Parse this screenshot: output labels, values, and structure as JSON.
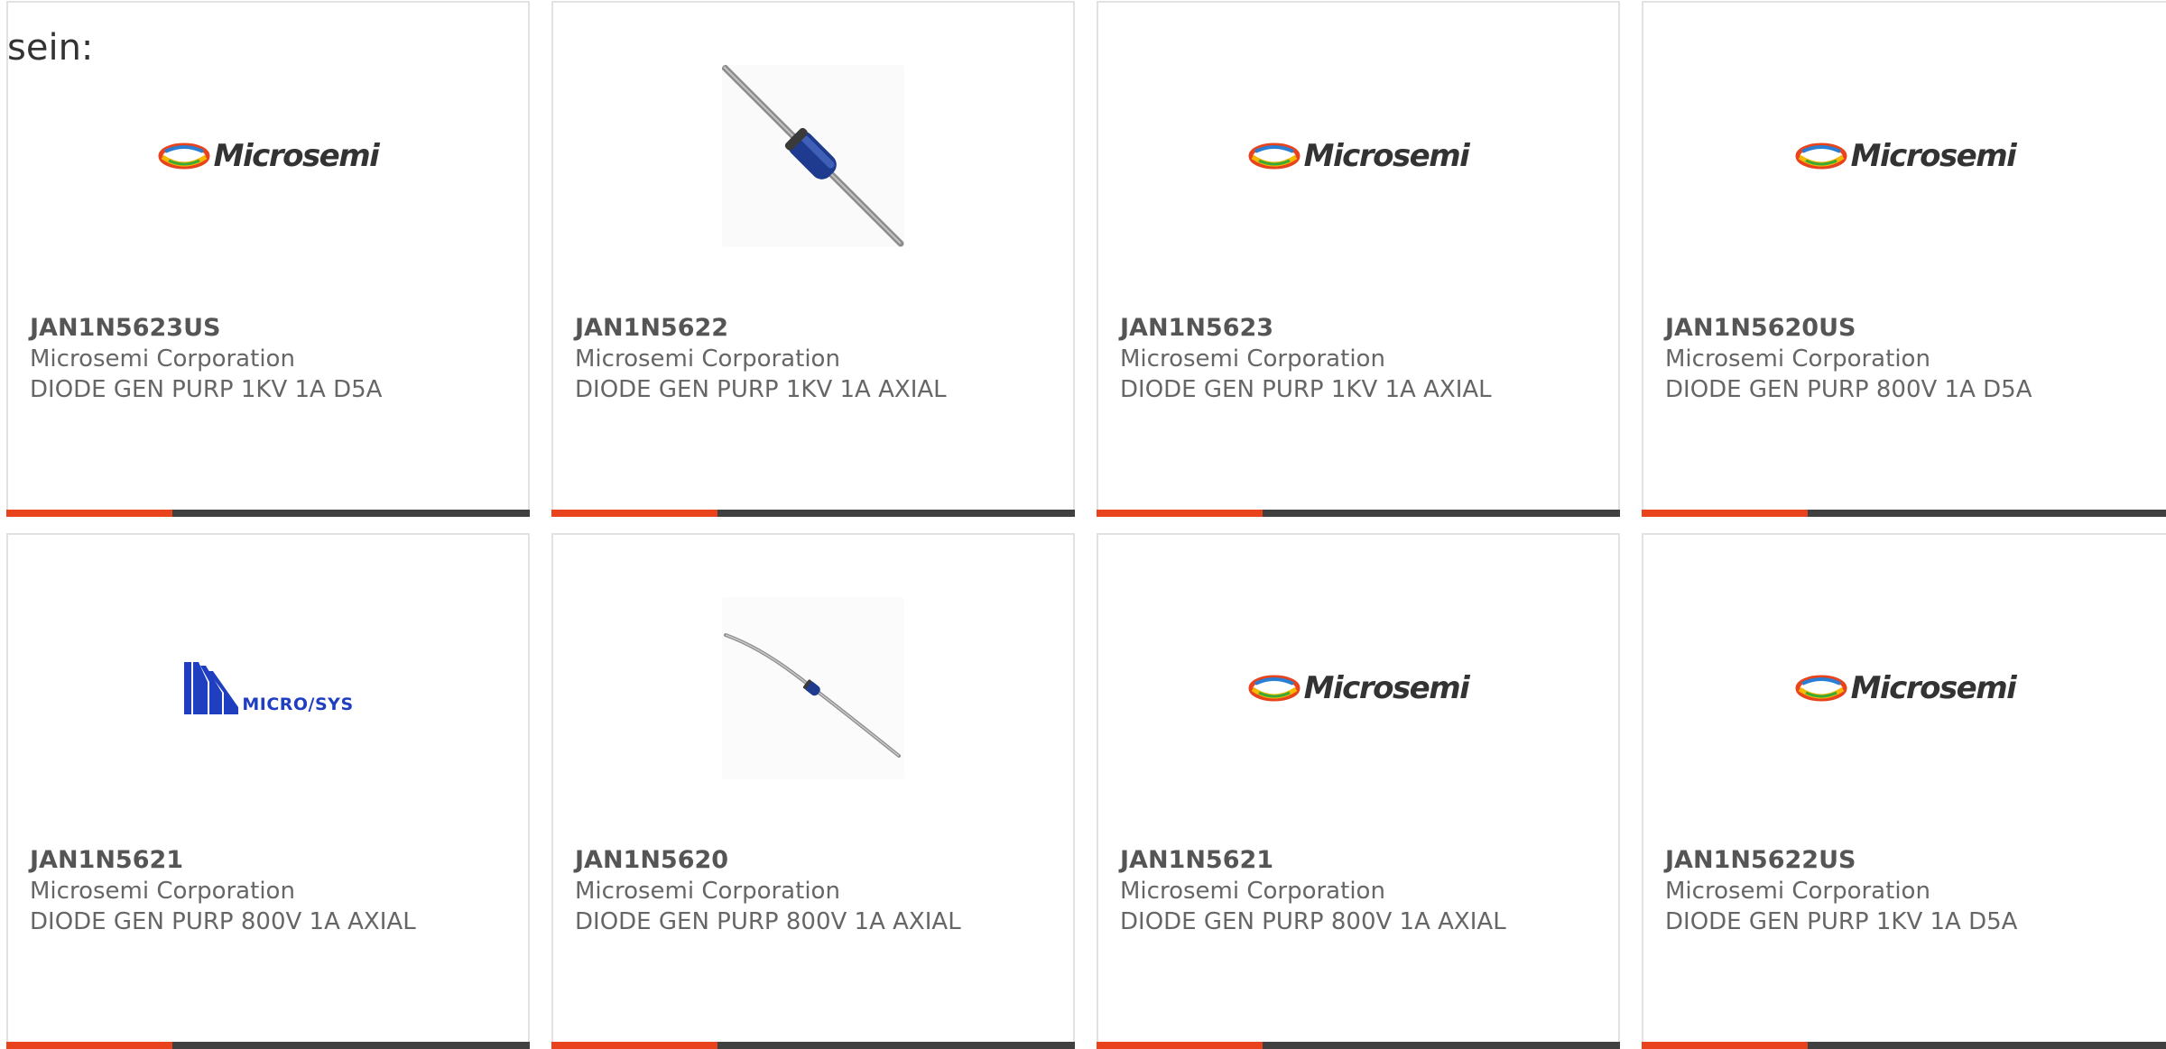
{
  "intro_text": "sein:",
  "colors": {
    "accent": "#e8431d",
    "bar": "#404040",
    "border": "#e2e2e2"
  },
  "logo_microsemi_text": "Microsemi",
  "logo_microsys_text": "MICRO/SYS",
  "products": [
    {
      "part_number": "JAN1N5623US",
      "manufacturer": "Microsemi Corporation",
      "description": "DIODE GEN PURP 1KV 1A D5A",
      "image": "microsemi-logo"
    },
    {
      "part_number": "JAN1N5622",
      "manufacturer": "Microsemi Corporation",
      "description": "DIODE GEN PURP 1KV 1A AXIAL",
      "image": "diode-photo-large"
    },
    {
      "part_number": "JAN1N5623",
      "manufacturer": "Microsemi Corporation",
      "description": "DIODE GEN PURP 1KV 1A AXIAL",
      "image": "microsemi-logo"
    },
    {
      "part_number": "JAN1N5620US",
      "manufacturer": "Microsemi Corporation",
      "description": "DIODE GEN PURP 800V 1A D5A",
      "image": "microsemi-logo"
    },
    {
      "part_number": "JAN1N5621",
      "manufacturer": "Microsemi Corporation",
      "description": "DIODE GEN PURP 800V 1A AXIAL",
      "image": "microsys-logo"
    },
    {
      "part_number": "JAN1N5620",
      "manufacturer": "Microsemi Corporation",
      "description": "DIODE GEN PURP 800V 1A AXIAL",
      "image": "diode-photo-small"
    },
    {
      "part_number": "JAN1N5621",
      "manufacturer": "Microsemi Corporation",
      "description": "DIODE GEN PURP 800V 1A AXIAL",
      "image": "microsemi-logo"
    },
    {
      "part_number": "JAN1N5622US",
      "manufacturer": "Microsemi Corporation",
      "description": "DIODE GEN PURP 1KV 1A D5A",
      "image": "microsemi-logo"
    }
  ]
}
